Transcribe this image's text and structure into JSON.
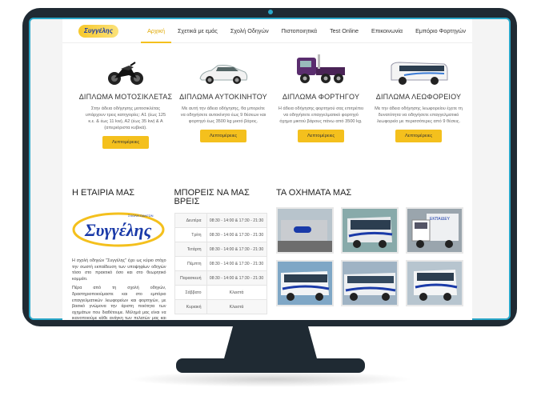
{
  "nav": {
    "logo_text": "Συγγέλης",
    "items": [
      "Αρχική",
      "Σχετικά με εμάς",
      "Σχολή Οδηγών",
      "Πιστοποιητικά",
      "Test Online",
      "Επικοινωνία",
      "Εμπόριο Φορτηγών"
    ]
  },
  "services": [
    {
      "title": "ΔΙΠΛΩΜΑ ΜΟΤΟΣΙΚΛΕΤΑΣ",
      "text": "Στην άδεια οδήγησης μοτοσικλέτας υπάρχουν τρεις κατηγορίες: Α1 (έως 125 κ.ε. & έως 11 kw), Α2 (έως 35 kw) & Α (απεριόριστα κυβικά).",
      "button": "Λεπτομέρειες"
    },
    {
      "title": "ΔΙΠΛΩΜΑ ΑΥΤΟΚΙΝΗΤΟΥ",
      "text": "Με αυτή την άδεια οδήγησης, θα μπορείτε να οδηγήσετε αυτοκίνητο έως 9 θέσεων και φορτηγό έως 3500 kg μικτό βάρος.",
      "button": "Λεπτομέρειες"
    },
    {
      "title": "ΔΙΠΛΩΜΑ ΦΟΡΤΗΓΟΥ",
      "text": "Η άδεια οδήγησης φορτηγού σας επιτρέπει να οδηγήσετε επαγγελματικό φορτηγό όχημα μικτού βάρους πάνω από 3500 kg.",
      "button": "Λεπτομέρειες"
    },
    {
      "title": "ΔΙΠΛΩΜΑ ΛΕΩΦΟΡΕΙΟΥ",
      "text": "Με την άδεια οδήγησης λεωφορείου έχετε τη δυνατότητα να οδηγήσετε επαγγελματικό λεωφορείο με περισσότερες από 9 θέσεις.",
      "button": "Λεπτομέρειες"
    }
  ],
  "company": {
    "heading": "Η ΕΤΑΙΡΙΑ ΜΑΣ",
    "logo_text": "Συγγέλης",
    "logo_subtext": "ΣΧΟΛΗ ΟΔΗΓΩΝ",
    "paragraph1": "Η σχολή οδηγών \"Συγγέλης\" έχει ως κύριο στόχο την σωστή εκπαίδευση των υποψηφίων οδηγών τόσο στο πρακτικό όσο και στο θεωρητικό κομμάτι.",
    "paragraph2": "Πέρα από τη σχολή οδηγών, δραστηριοποιούμαστε και στο εμπόριο επαγγελματικών λεωφορείων και φορτηγών, με βασικό γνώμονα την άριστη ποιότητα των οχημάτων που διαθέτουμε. Μέλημά μας είναι να ικανοποιούμε κάθε ανάγκη των πελατών μας και να είμαστε δίπλα τους."
  },
  "hours": {
    "heading": "ΜΠΟΡΕΙΣ ΝΑ ΜΑΣ ΒΡΕΙΣ",
    "rows": [
      {
        "day": "Δευτέρα",
        "time": "08:30 - 14:00 & 17:30 - 21:30"
      },
      {
        "day": "Τρίτη",
        "time": "08:30 - 14:00 & 17:30 - 21:30"
      },
      {
        "day": "Τετάρτη",
        "time": "08:30 - 14:00 & 17:30 - 21:30"
      },
      {
        "day": "Πέμπτη",
        "time": "08:30 - 14:00 & 17:30 - 21:30"
      },
      {
        "day": "Παρασκευή",
        "time": "08:30 - 14:00 & 17:30 - 21:30"
      },
      {
        "day": "Σάββατο",
        "time": "Κλειστά"
      },
      {
        "day": "Κυριακή",
        "time": "Κλειστά"
      }
    ]
  },
  "gallery": {
    "heading": "ΤΑ ΟΧΗΜΑΤΑ ΜΑΣ",
    "badge": "ΕΚΠΑΙΔΕΥ"
  },
  "colors": {
    "accent": "#f4c01d",
    "monitor": "#1f2a33",
    "screen_edge": "#2aa7c9",
    "brand_blue": "#1a3aa8"
  }
}
